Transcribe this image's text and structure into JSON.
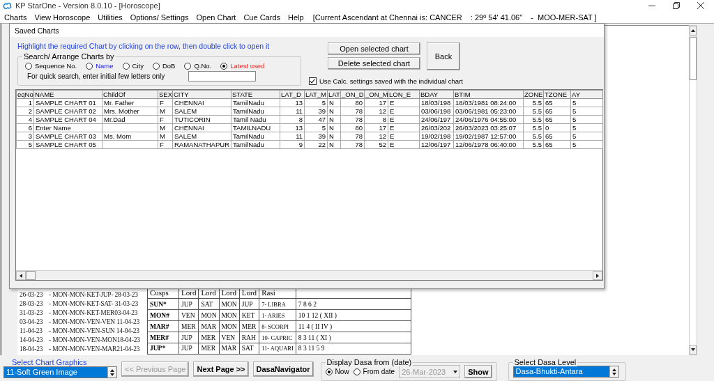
{
  "window": {
    "title": "KP StarOne - Version 8.0.10 - [Horoscope]"
  },
  "menu": [
    {
      "label": "Charts"
    },
    {
      "label": "View Horoscope"
    },
    {
      "label": "Utilities"
    },
    {
      "label": "Options/ Settings"
    },
    {
      "label": "Open Chart"
    },
    {
      "label": "Cue Cards"
    },
    {
      "label": "Help"
    }
  ],
  "ascendant_info": "[Current Ascendant at Chennai is: CANCER    : 29º 54' 41.06\"    -  MOO-MER-SAT ]",
  "horoscope": {
    "dasa_periods": [
      {
        "start": "26-03-23",
        "period": "- MON-MON-KET-JUP- 28-03-23"
      },
      {
        "start": "28-03-23",
        "period": "- MON-MON-KET-SAT- 31-03-23"
      },
      {
        "start": "31-03-23",
        "period": "- MON-MON-KET-MER03-04-23"
      },
      {
        "start": "03-04-23",
        "period": "- MON-MON-VEN-VEN 11-04-23"
      },
      {
        "start": "11-04-23",
        "period": "- MON-MON-VEN-SUN 14-04-23"
      },
      {
        "start": "14-04-23",
        "period": "- MON-MON-VEN-MON18-04-23"
      },
      {
        "start": "18-04-23",
        "period": "- MON-MON-VEN-MAR21-04-23"
      }
    ],
    "cusps_table": {
      "columns": [
        "Cusps",
        "Lord",
        "Lord",
        "Lord",
        "Lord",
        "Rasi"
      ],
      "rows": [
        [
          "SUN*",
          "JUP",
          "SAT",
          "MON",
          "JUP",
          "7- LIBRA",
          "7  8  6  2"
        ],
        [
          "MON#",
          "VEN",
          "MON",
          "MON",
          "KET",
          "1- ARIES",
          "10  1  12 ( XII )"
        ],
        [
          "MAR#",
          "MER",
          "MAR",
          "MON",
          "MER",
          "8- SCORPI",
          "11  4 ( II  IV )"
        ],
        [
          "MER#",
          "JUP",
          "MER",
          "VEN",
          "RAH",
          "10- CAPRIC",
          "8  3  11 ( XI )"
        ],
        [
          "JUP*",
          "JUP",
          "MER",
          "MAR",
          "SAT",
          "11- AQUARI",
          "8  3  11  5  9"
        ]
      ]
    }
  },
  "saved_charts_dialog": {
    "title": "Saved Charts",
    "instruction": "Highlight the required Chart by clicking on the row, then double click to open it",
    "search": {
      "title": "Search/ Arrange Charts by",
      "options": [
        {
          "label": "Sequence No.",
          "selected": false,
          "kind": "plain"
        },
        {
          "label": "Name",
          "selected": false,
          "kind": "accent"
        },
        {
          "label": "City",
          "selected": false,
          "kind": "plain"
        },
        {
          "label": "DoB",
          "selected": false,
          "kind": "plain"
        },
        {
          "label": "Q.No.",
          "selected": false,
          "kind": "plain"
        },
        {
          "label": "Latest used",
          "selected": true,
          "kind": "alert"
        }
      ],
      "quick_search_label": "For quick search, enter initial few letters only"
    },
    "buttons": [
      {
        "label": "Open selected chart"
      },
      {
        "label": "Delete selected chart"
      }
    ],
    "back_button": "Back",
    "use_calc_settings": {
      "label": "Use Calc. settings saved with the individual chart",
      "checked": true
    },
    "table": {
      "columns": [
        "eqNo",
        "NAME",
        "ChildOf",
        "SEX",
        "CITY",
        "STATE",
        "LAT_D",
        "LAT_M",
        "LAT",
        "_ON_D",
        "_ON_M",
        "LON_E",
        "BDAY",
        "BTIM",
        "ZONE",
        "TZONE",
        "AY"
      ],
      "rows": [
        [
          "1",
          "SAMPLE CHART 01",
          "Mr. Father",
          "F",
          "CHENNAI",
          "TamilNadu",
          "13",
          "5",
          "N",
          "80",
          "17",
          "E",
          "18/03/198",
          "18/03/1981 08:24:00",
          "5.5",
          "65",
          "5"
        ],
        [
          "2",
          "SAMPLE CHART 02",
          "Mrs. Mother",
          "M",
          "SALEM",
          "TamilNadu",
          "11",
          "39",
          "N",
          "78",
          "12",
          "E",
          "03/06/198",
          "03/06/1981 05:23:00",
          "5.5",
          "65",
          "5"
        ],
        [
          "4",
          "SAMPLE CHART 04",
          "Mr.Dad",
          "F",
          "TUTICORIN",
          "Tamil Nadu",
          "8",
          "47",
          "N",
          "78",
          "8",
          "E",
          "24/06/197",
          "24/06/1976 04:55:00",
          "5.5",
          "65",
          "5"
        ],
        [
          "6",
          "Enter Name",
          "",
          "M",
          "CHENNAI",
          "TAMILNADU",
          "13",
          "5",
          "N",
          "80",
          "17",
          "E",
          "26/03/202",
          "26/03/2023 03:25:07",
          "5.5",
          "0",
          "5"
        ],
        [
          "3",
          "SAMPLE CHART 03",
          "Ms. Mom",
          "M",
          "SALEM",
          "TamilNadu",
          "11",
          "39",
          "N",
          "78",
          "12",
          "E",
          "19/02/198",
          "19/02/1987 12:57:00",
          "5.5",
          "65",
          "5"
        ],
        [
          "5",
          "SAMPLE CHART 05",
          "",
          "F",
          "RAMANATHAPUR",
          "TamilNadu",
          "9",
          "22",
          "N",
          "78",
          "52",
          "E",
          "12/06/197",
          "12/06/1978 06:40:00",
          "5.5",
          "65",
          "5"
        ]
      ]
    }
  },
  "bottom_bar": {
    "chart_graphics": {
      "label": "Select Chart Graphics",
      "value": "11-Soft Green Image"
    },
    "buttons": [
      {
        "label": "<< Previous Page",
        "disabled": true
      },
      {
        "label": "Next Page >>",
        "disabled": false
      },
      {
        "label": "DasaNavigator",
        "disabled": false
      }
    ],
    "display_dasa": {
      "title": "Display Dasa from (date)",
      "options": [
        {
          "label": "Now",
          "selected": true
        },
        {
          "label": "From date",
          "selected": false
        }
      ],
      "date": {
        "value": "26-Mar-2023",
        "disabled": true
      },
      "show_button": "Show"
    },
    "dasa_level": {
      "label": "Select Dasa Level",
      "value": "Dasa-Bhukti-Antara"
    }
  }
}
